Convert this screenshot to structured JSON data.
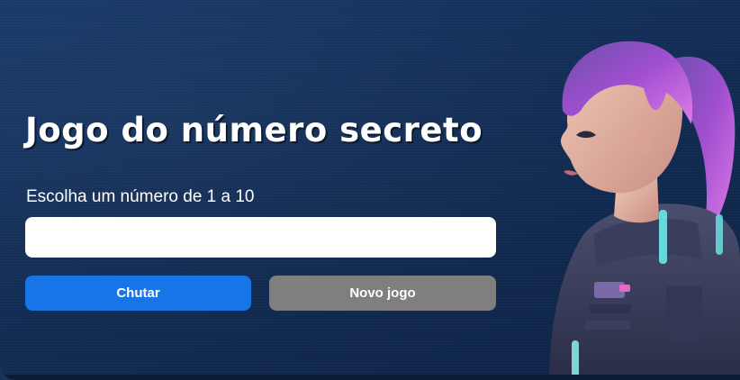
{
  "game": {
    "title": "Jogo do número secreto",
    "prompt": "Escolha um número de 1 a 10",
    "input_value": "",
    "input_placeholder": ""
  },
  "buttons": {
    "guess_label": "Chutar",
    "new_game_label": "Novo jogo"
  },
  "colors": {
    "background": "#14325a",
    "guess_button": "#1875e8",
    "new_game_button": "#7f7f7f",
    "text": "#ffffff"
  },
  "illustration": {
    "icon": "astronaut-girl-illustration"
  }
}
